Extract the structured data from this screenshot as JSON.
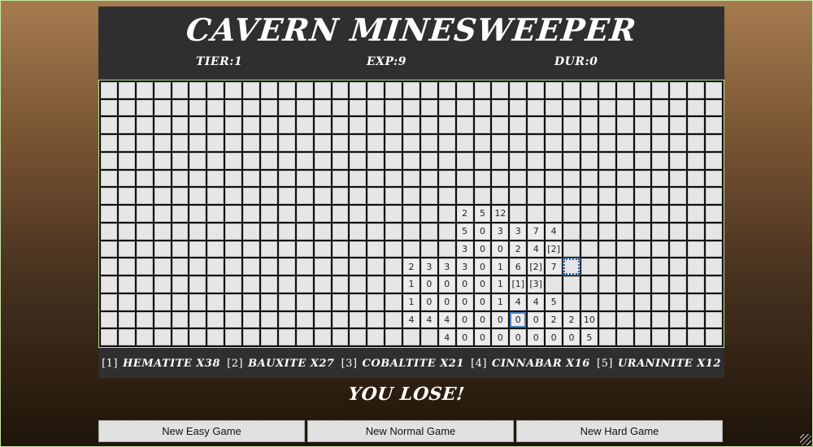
{
  "game": {
    "title": "CAVERN MINESWEEPER",
    "stats": {
      "tier": "TIER:1",
      "exp": "EXP:9",
      "dur": "DUR:0"
    },
    "result": "YOU LOSE!"
  },
  "board": {
    "cols": 35,
    "rows": 15,
    "revealed": [
      {
        "r": 7,
        "c": 20,
        "v": "2"
      },
      {
        "r": 7,
        "c": 21,
        "v": "5"
      },
      {
        "r": 7,
        "c": 22,
        "v": "12"
      },
      {
        "r": 8,
        "c": 20,
        "v": "5"
      },
      {
        "r": 8,
        "c": 21,
        "v": "0"
      },
      {
        "r": 8,
        "c": 22,
        "v": "3"
      },
      {
        "r": 8,
        "c": 23,
        "v": "3"
      },
      {
        "r": 8,
        "c": 24,
        "v": "7"
      },
      {
        "r": 8,
        "c": 25,
        "v": "4"
      },
      {
        "r": 9,
        "c": 20,
        "v": "3"
      },
      {
        "r": 9,
        "c": 21,
        "v": "0"
      },
      {
        "r": 9,
        "c": 22,
        "v": "0"
      },
      {
        "r": 9,
        "c": 23,
        "v": "2"
      },
      {
        "r": 9,
        "c": 24,
        "v": "4"
      },
      {
        "r": 9,
        "c": 25,
        "v": "[2]"
      },
      {
        "r": 10,
        "c": 17,
        "v": "2"
      },
      {
        "r": 10,
        "c": 18,
        "v": "3"
      },
      {
        "r": 10,
        "c": 19,
        "v": "3"
      },
      {
        "r": 10,
        "c": 20,
        "v": "3"
      },
      {
        "r": 10,
        "c": 21,
        "v": "0"
      },
      {
        "r": 10,
        "c": 22,
        "v": "1"
      },
      {
        "r": 10,
        "c": 23,
        "v": "6"
      },
      {
        "r": 10,
        "c": 24,
        "v": "[2]"
      },
      {
        "r": 10,
        "c": 25,
        "v": "7"
      },
      {
        "r": 11,
        "c": 17,
        "v": "1"
      },
      {
        "r": 11,
        "c": 18,
        "v": "0"
      },
      {
        "r": 11,
        "c": 19,
        "v": "0"
      },
      {
        "r": 11,
        "c": 20,
        "v": "0"
      },
      {
        "r": 11,
        "c": 21,
        "v": "0"
      },
      {
        "r": 11,
        "c": 22,
        "v": "1"
      },
      {
        "r": 11,
        "c": 23,
        "v": "[1]"
      },
      {
        "r": 11,
        "c": 24,
        "v": "[3]"
      },
      {
        "r": 12,
        "c": 17,
        "v": "1"
      },
      {
        "r": 12,
        "c": 18,
        "v": "0"
      },
      {
        "r": 12,
        "c": 19,
        "v": "0"
      },
      {
        "r": 12,
        "c": 20,
        "v": "0"
      },
      {
        "r": 12,
        "c": 21,
        "v": "0"
      },
      {
        "r": 12,
        "c": 22,
        "v": "1"
      },
      {
        "r": 12,
        "c": 23,
        "v": "4"
      },
      {
        "r": 12,
        "c": 24,
        "v": "4"
      },
      {
        "r": 12,
        "c": 25,
        "v": "5"
      },
      {
        "r": 13,
        "c": 17,
        "v": "4"
      },
      {
        "r": 13,
        "c": 18,
        "v": "4"
      },
      {
        "r": 13,
        "c": 19,
        "v": "4"
      },
      {
        "r": 13,
        "c": 20,
        "v": "0"
      },
      {
        "r": 13,
        "c": 21,
        "v": "0"
      },
      {
        "r": 13,
        "c": 22,
        "v": "0"
      },
      {
        "r": 13,
        "c": 23,
        "v": "0",
        "hl": true
      },
      {
        "r": 13,
        "c": 24,
        "v": "0"
      },
      {
        "r": 13,
        "c": 25,
        "v": "2"
      },
      {
        "r": 13,
        "c": 26,
        "v": "2"
      },
      {
        "r": 13,
        "c": 27,
        "v": "10"
      },
      {
        "r": 14,
        "c": 19,
        "v": "4"
      },
      {
        "r": 14,
        "c": 20,
        "v": "0"
      },
      {
        "r": 14,
        "c": 21,
        "v": "0"
      },
      {
        "r": 14,
        "c": 22,
        "v": "0"
      },
      {
        "r": 14,
        "c": 23,
        "v": "0"
      },
      {
        "r": 14,
        "c": 24,
        "v": "0"
      },
      {
        "r": 14,
        "c": 25,
        "v": "0"
      },
      {
        "r": 14,
        "c": 26,
        "v": "0"
      },
      {
        "r": 14,
        "c": 27,
        "v": "5"
      }
    ],
    "selected": {
      "r": 10,
      "c": 26
    }
  },
  "legend": [
    {
      "key": "[1]",
      "label": "HEMATITE X38"
    },
    {
      "key": "[2]",
      "label": "BAUXITE X27"
    },
    {
      "key": "[3]",
      "label": "COBALTITE X21"
    },
    {
      "key": "[4]",
      "label": "CINNABAR X16"
    },
    {
      "key": "[5]",
      "label": "URANINITE X12"
    }
  ],
  "buttons": {
    "easy": "New Easy Game",
    "normal": "New Normal Game",
    "hard": "New Hard Game"
  }
}
